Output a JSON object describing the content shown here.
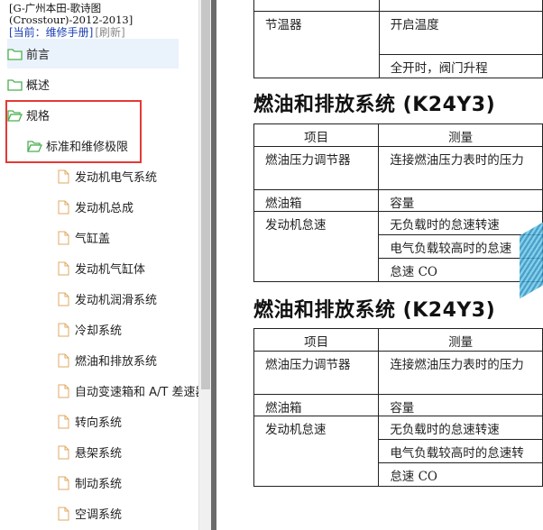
{
  "nav": {
    "doc_title_line1": "[G-广州本田-歌诗图",
    "doc_title_line2": "(Crosstour)-2012-2013]",
    "current_label": "[当前：维修手册]",
    "refresh_label": "[刷新]",
    "items": [
      {
        "label": "前言",
        "icon": "folder-icon"
      },
      {
        "label": "概述",
        "icon": "folder-icon"
      },
      {
        "label": "规格",
        "icon": "folder-open-icon"
      },
      {
        "label": "标准和维修极限",
        "icon": "folder-open-icon"
      },
      {
        "label": "发动机电气系统",
        "icon": "document-icon"
      },
      {
        "label": "发动机总成",
        "icon": "document-icon"
      },
      {
        "label": "气缸盖",
        "icon": "document-icon"
      },
      {
        "label": "发动机气缸体",
        "icon": "document-icon"
      },
      {
        "label": "发动机润滑系统",
        "icon": "document-icon"
      },
      {
        "label": "冷却系统",
        "icon": "document-icon"
      },
      {
        "label": "燃油和排放系统",
        "icon": "document-icon"
      },
      {
        "label": "自动变速箱和 A/T 差速器",
        "icon": "document-icon"
      },
      {
        "label": "转向系统",
        "icon": "document-icon"
      },
      {
        "label": "悬架系统",
        "icon": "document-icon"
      },
      {
        "label": "制动系统",
        "icon": "document-icon"
      },
      {
        "label": "空调系统",
        "icon": "document-icon"
      }
    ]
  },
  "content": {
    "top_table": {
      "row_label": "节温器",
      "cell1": "开启温度",
      "cell2": "全开时，阀门升程"
    },
    "sections": [
      {
        "title": "燃油和排放系统 (K24Y3)",
        "header_item": "项目",
        "header_measure": "测量",
        "rows": [
          {
            "item": "燃油压力调节器",
            "measure": "连接燃油压力表时的压力"
          },
          {
            "item": "燃油箱",
            "measure": "容量"
          },
          {
            "item": "发动机怠速",
            "measure": "无负载时的怠速转速"
          },
          {
            "item": "",
            "measure": "电气负载较高时的怠速"
          },
          {
            "item": "",
            "measure": "怠速 CO"
          }
        ]
      },
      {
        "title": "燃油和排放系统 (K24Y3)",
        "header_item": "项目",
        "header_measure": "测量",
        "rows": [
          {
            "item": "燃油压力调节器",
            "measure": "连接燃油压力表时的压力"
          },
          {
            "item": "燃油箱",
            "measure": "容量"
          },
          {
            "item": "发动机怠速",
            "measure": "无负载时的怠速转速"
          },
          {
            "item": "",
            "measure": "电气负载较高时的怠速转"
          },
          {
            "item": "",
            "measure": "怠速 CO"
          }
        ]
      }
    ]
  },
  "colors": {
    "folder_green": "#4caf50",
    "link_blue": "#1a3fb5",
    "highlight_box_red": "#e53935",
    "selected_row_bg": "#eaf2fb"
  }
}
